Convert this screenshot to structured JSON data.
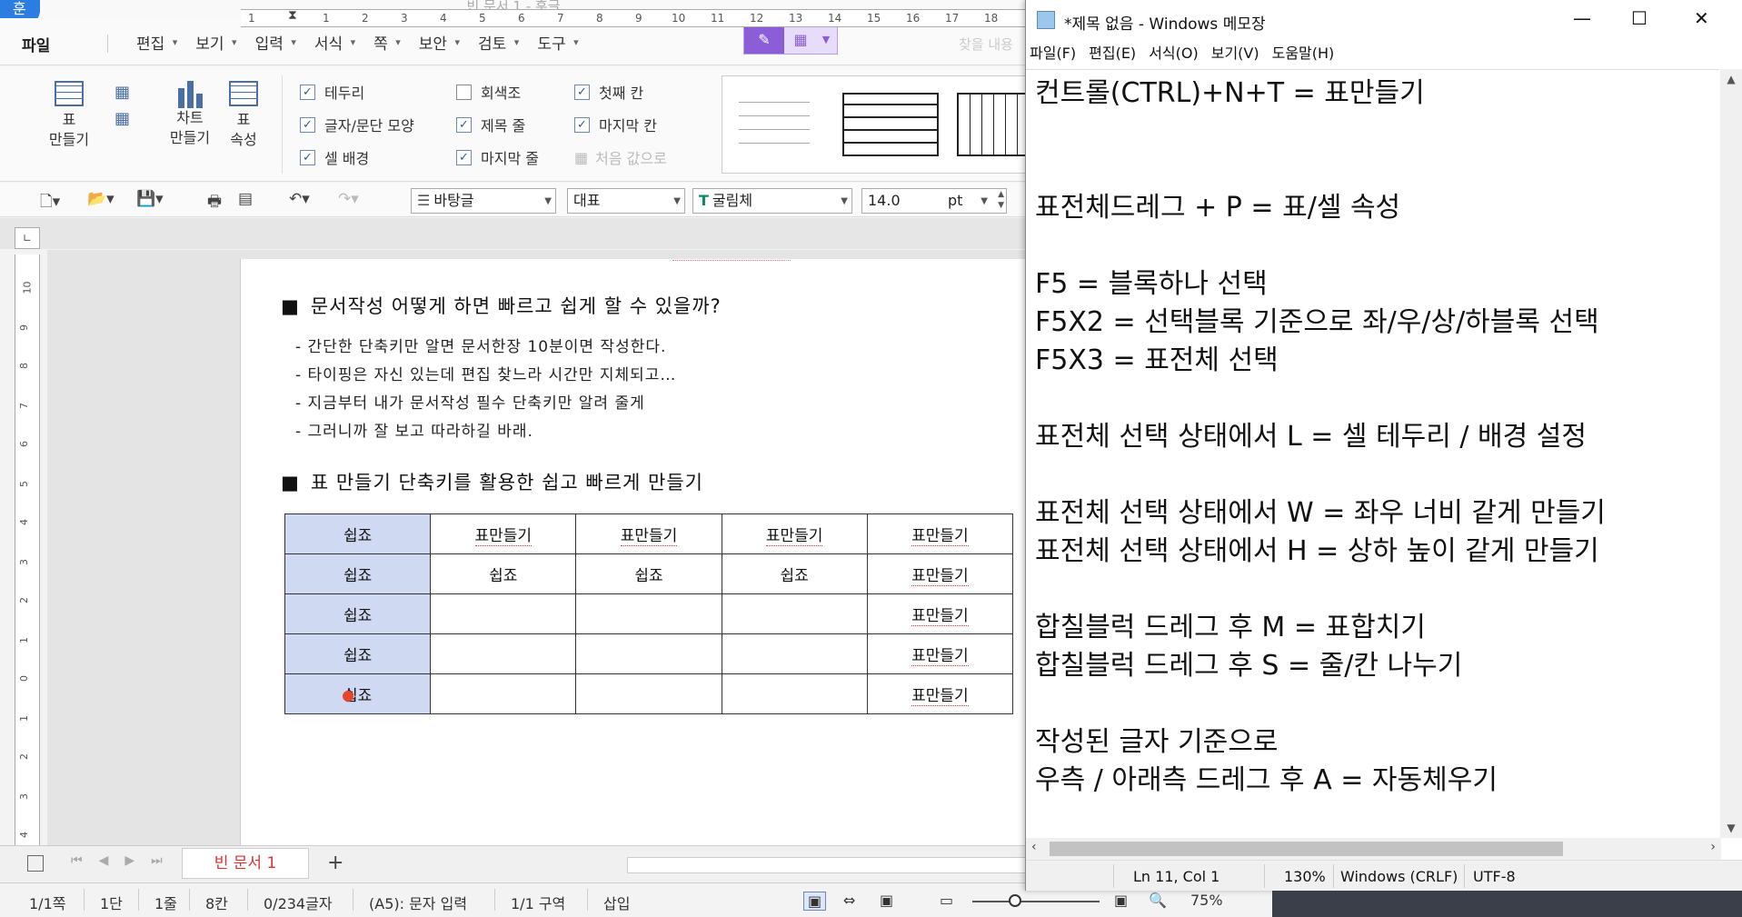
{
  "hwp": {
    "window_title": "빈 문서 1 - 훈글",
    "logo": "훈",
    "menu": {
      "file": "파일",
      "items": [
        "편집",
        "보기",
        "입력",
        "서식",
        "쪽",
        "보안",
        "검토",
        "도구"
      ],
      "search_placeholder": "찾을 내용"
    },
    "ribbon": {
      "table_create": "표\n만들기",
      "chart_create": "차트\n만들기",
      "table_props": "표\n속성",
      "checks": [
        {
          "label": "테두리",
          "checked": true
        },
        {
          "label": "글자/문단 모양",
          "checked": true
        },
        {
          "label": "셀 배경",
          "checked": true
        },
        {
          "label": "회색조",
          "checked": false
        },
        {
          "label": "제목 줄",
          "checked": true
        },
        {
          "label": "마지막 줄",
          "checked": true
        },
        {
          "label": "첫째 칸",
          "checked": true
        },
        {
          "label": "마지막 칸",
          "checked": true
        },
        {
          "label": "처음 값으로",
          "disabled": true
        }
      ]
    },
    "toolbar": {
      "style": "바탕글",
      "lang": "대표",
      "font": "굴림체",
      "font_size": "14.0",
      "unit": "pt"
    },
    "ruler_h": [
      "1",
      "1",
      "2",
      "3",
      "4",
      "5",
      "6",
      "7",
      "8",
      "9",
      "10",
      "11",
      "12",
      "13",
      "14",
      "15",
      "16",
      "17",
      "18",
      "19"
    ],
    "ruler_v": [
      "10",
      "9",
      "8",
      "7",
      "6",
      "5",
      "4",
      "3",
      "2",
      "1",
      "0",
      "1",
      "2",
      "3",
      "4"
    ],
    "doc": {
      "heading1": "문서작성 어떻게 하면 빠르고 쉽게 할 수 있을까?",
      "lines": [
        "- 간단한 단축키만 알면 문서한장 10분이면 작성한다.",
        "- 타이핑은 자신 있는데 편집 찾느라 시간만 지체되고…",
        "- 지금부터 내가 문서작성 필수 단축키만 알려 줄게",
        "- 그러니까 잘 보고 따라하길 바래."
      ],
      "heading2": "표 만들기 단축키를 활용한 쉽고 빠르게 만들기",
      "table": [
        [
          "쉽죠",
          "표만들기",
          "표만들기",
          "표만들기",
          "표만들기"
        ],
        [
          "쉽죠",
          "쉽죠",
          "쉽죠",
          "쉽죠",
          "표만들기"
        ],
        [
          "쉽죠",
          "",
          "",
          "",
          "표만들기"
        ],
        [
          "쉽죠",
          "",
          "",
          "",
          "표만들기"
        ],
        [
          "쉽죠",
          "",
          "",
          "",
          "표만들기"
        ]
      ]
    },
    "tab": {
      "doc_name": "빈 문서 1",
      "add": "+"
    },
    "status": [
      "1/1쪽",
      "1단",
      "1줄",
      "8칸",
      "0/234글자",
      "(A5): 문자 입력",
      "1/1 구역",
      "삽입"
    ],
    "zoom": "75%"
  },
  "notepad": {
    "title": "*제목 없음 - Windows 메모장",
    "menu": [
      "파일(F)",
      "편집(E)",
      "서식(O)",
      "보기(V)",
      "도움말(H)"
    ],
    "lines": [
      "컨트롤(CTRL)+N+T = 표만들기",
      "",
      "",
      "표전체드레그 + P = 표/셀 속성",
      "",
      "F5 = 블록하나 선택",
      "F5X2 = 선택블록 기준으로 좌/우/상/하블록 선택",
      "F5X3 = 표전체 선택",
      "",
      "표전체 선택 상태에서 L = 셀 테두리 / 배경 설정",
      "",
      "표전체 선택 상태에서 W = 좌우 너비 같게 만들기",
      "표전체 선택 상태에서 H = 상하 높이 같게 만들기",
      "",
      "합칠블럭 드레그 후 M = 표합치기",
      "합칠블럭 드레그 후 S = 줄/칸 나누기",
      "",
      "작성된 글자 기준으로",
      "우측 / 아래측 드레그 후 A = 자동체우기"
    ],
    "status": {
      "position": "Ln 11, Col 1",
      "zoom": "130%",
      "eol": "Windows (CRLF)",
      "encoding": "UTF-8"
    }
  }
}
